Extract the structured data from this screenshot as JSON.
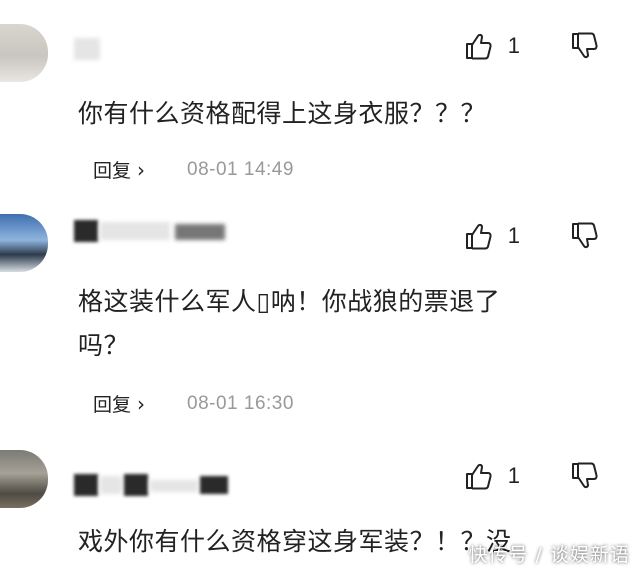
{
  "comments": [
    {
      "likes": "1",
      "text": "你有什么资格配得上这身衣服？？？",
      "reply_label": "回复",
      "reply_chevron": "›",
      "timestamp": "08-01 14:49"
    },
    {
      "likes": "1",
      "text_line1": "格这装什么军人▯呐！你战狼的票退了",
      "text_line2": "吗？",
      "reply_label": "回复",
      "reply_chevron": "›",
      "timestamp": "08-01 16:30"
    },
    {
      "likes": "1",
      "text": "戏外你有什么资格穿这身军装？！？没"
    }
  ],
  "icons": {
    "like": "thumbs-up-icon",
    "dislike": "thumbs-down-icon"
  },
  "watermark": "快传号 / 谈娱新语"
}
